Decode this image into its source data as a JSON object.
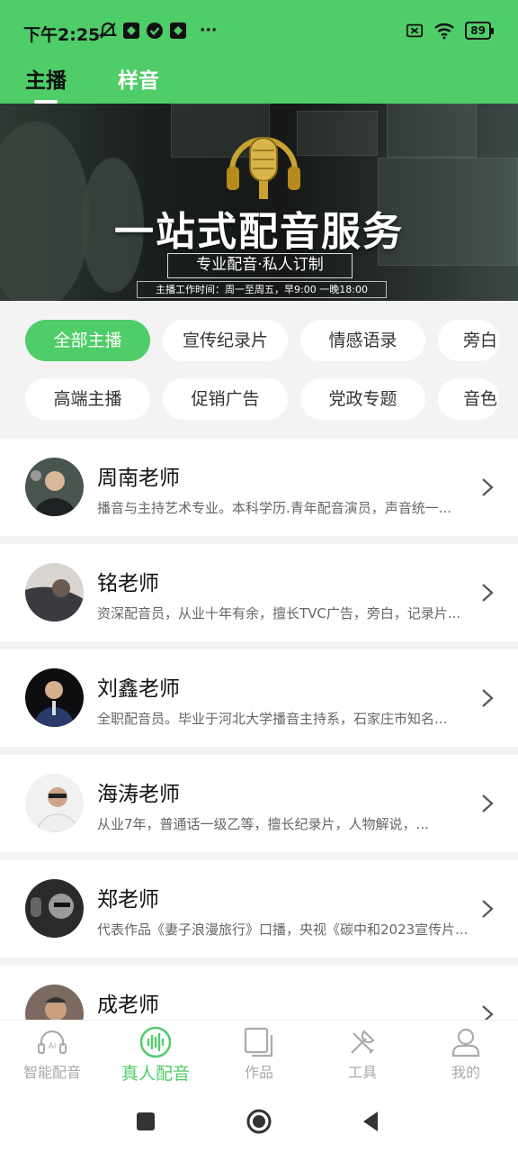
{
  "status_bar": {
    "time": "下午2:25",
    "more": "···",
    "battery": "89"
  },
  "tabs": [
    {
      "label": "主播",
      "active": true
    },
    {
      "label": "样音",
      "active": false
    }
  ],
  "banner": {
    "title": "一站式配音服务",
    "subtitle": "专业配音·私人订制",
    "hours": "主播工作时间：周一至周五，早9:00 一晚18:00"
  },
  "filters": {
    "row1": [
      "全部主播",
      "宣传纪录片",
      "情感语录",
      "旁白"
    ],
    "row2": [
      "高端主播",
      "促销广告",
      "党政专题",
      "音色"
    ],
    "active": "全部主播"
  },
  "anchors": [
    {
      "name": "周南老师",
      "desc": "播音与主持艺术专业。本科学历.青年配音演员，声音统一..."
    },
    {
      "name": "铭老师",
      "desc": "资深配音员，从业十年有余，擅长TVC广告，旁白，记录片..."
    },
    {
      "name": "刘鑫老师",
      "desc": "全职配音员。毕业于河北大学播音主持系，石家庄市知名..."
    },
    {
      "name": "海涛老师",
      "desc": "从业7年，普通话一级乙等，擅长纪录片，人物解说，..."
    },
    {
      "name": "郑老师",
      "desc": "代表作品《妻子浪漫旅行》口播，央视《碳中和2023宣传片..."
    },
    {
      "name": "成老师",
      "desc": ""
    }
  ],
  "bottom_nav": [
    {
      "label": "智能配音",
      "icon": "ai-headset-icon",
      "active": false
    },
    {
      "label": "真人配音",
      "icon": "voice-wave-icon",
      "active": true
    },
    {
      "label": "作品",
      "icon": "works-icon",
      "active": false
    },
    {
      "label": "工具",
      "icon": "tools-icon",
      "active": false
    },
    {
      "label": "我的",
      "icon": "profile-icon",
      "active": false
    }
  ],
  "colors": {
    "accent": "#4fcd69",
    "text": "#111111",
    "muted": "#666666"
  }
}
